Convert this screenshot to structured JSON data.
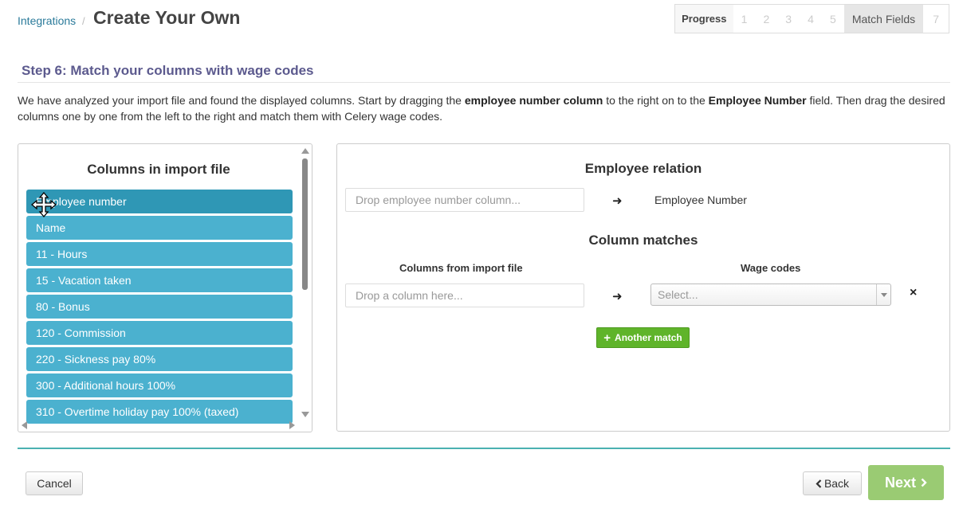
{
  "header": {
    "breadcrumb_link": "Integrations",
    "breadcrumb_separator": "/",
    "title": "Create Your Own"
  },
  "progress": {
    "label": "Progress",
    "steps": [
      "1",
      "2",
      "3",
      "4",
      "5",
      "Match Fields",
      "7"
    ],
    "active_step": "Match Fields"
  },
  "step": {
    "heading": "Step 6: Match your columns with wage codes",
    "intro_1": "We have analyzed your import file and found the displayed columns. Start by dragging the ",
    "intro_b1": "employee number column",
    "intro_2": " to the right on to the ",
    "intro_b2": "Employee Number",
    "intro_3": " field. Then drag the desired columns one by one from the left to the right and match them with Celery wage codes."
  },
  "left_panel": {
    "title": "Columns in import file",
    "columns": [
      "Employee number",
      "Name",
      "11 - Hours",
      "15 - Vacation taken",
      "80 - Bonus",
      "120 - Commission",
      "220 - Sickness pay 80%",
      "300 - Additional hours 100%",
      "310 - Overtime holiday pay 100% (taxed)"
    ]
  },
  "right_panel": {
    "employee_relation_title": "Employee relation",
    "employee_drop_placeholder": "Drop employee number column...",
    "employee_number_label": "Employee Number",
    "column_matches_title": "Column matches",
    "columns_from_file_header": "Columns from import file",
    "wage_codes_header": "Wage codes",
    "column_drop_placeholder": "Drop a column here...",
    "wage_code_select_placeholder": "Select...",
    "arrow_icon": "arrow-right-icon",
    "remove_icon": "×",
    "another_match_label": "Another match"
  },
  "footer": {
    "cancel_label": "Cancel",
    "back_label": "Back",
    "next_label": "Next"
  },
  "colors": {
    "column_item": "#4bb1cf",
    "column_item_active": "#2f97b5",
    "add_button": "#5fb42a",
    "next_button": "#9acb73",
    "heading": "#5c5a8e",
    "footer_rule": "#4bb1b1"
  }
}
